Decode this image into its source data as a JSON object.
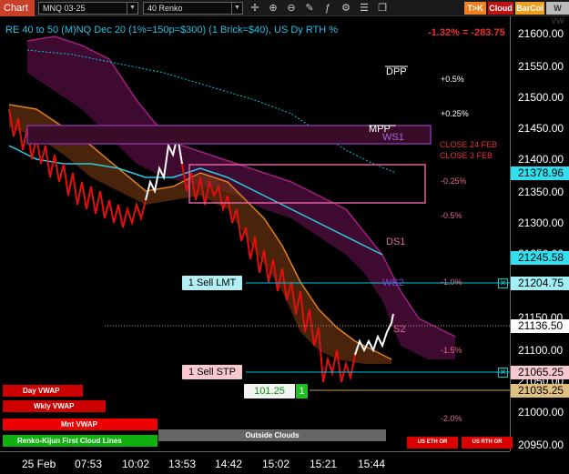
{
  "toolbar": {
    "chart_tab": "Chart",
    "symbol": "MNQ 03-25",
    "bar_type": "40 Renko",
    "icons": [
      "crosshair-icon",
      "zoom-in-icon",
      "zoom-out-icon",
      "draw-icon",
      "indicator-icon",
      "strategy-icon",
      "properties-icon",
      "duplicate-icon"
    ],
    "btn_tok": "T>K",
    "btn_cloud": "Cloud",
    "btn_barcol": "BarCol",
    "btn_ww": "W VW"
  },
  "chart_title": "RE 40 to 50 (M)NQ Dec 20 (1%=150p=$300) (1 Brick=$40), US Dy RTH %",
  "pnl": "-1.32% = -283.75",
  "price_axis": [
    "21600.00",
    "21550.00",
    "21500.00",
    "21450.00",
    "21400.00",
    "21350.00",
    "21300.00",
    "21250.00",
    "21200.00",
    "21150.00",
    "21100.00",
    "21050.00",
    "21000.00",
    "20950.00"
  ],
  "time_axis": [
    "25 Feb",
    "07:53",
    "10:02",
    "13:53",
    "14:42",
    "15:02",
    "15:21",
    "15:44"
  ],
  "price_tags": {
    "last": "21378.96",
    "p1": "21245.58",
    "p2": "21204.75",
    "p3": "21136.50",
    "p4": "21065.25",
    "p5": "21035.25"
  },
  "levels": {
    "dpp": "DPP",
    "mpp": "MPP",
    "ws1": "WS1",
    "ds1": "DS1",
    "ws2": "WS2",
    "ds2": "S2",
    "close24": "CLOSE 24 FEB",
    "close3": "CLOSE 3 FEB"
  },
  "percents": [
    "+0.5%",
    "+0.25%",
    "-0.25%",
    "-0.5%",
    "-1.0%",
    "-1.5%",
    "-2.0%"
  ],
  "orders": {
    "sell_lmt": "1 Sell LMT",
    "sell_stp": "1 Sell STP",
    "position_price": "101.25",
    "position_qty": "1",
    "close_icon": "close-icon"
  },
  "panel": {
    "day_vwap": "Day VWAP",
    "wkly_vwap": "Wkly VWAP",
    "mnt_vwap": "Mnt VWAP",
    "renko_kijun": "Renko-Kijun First Cloud Lines",
    "outside_clouds": "Outside Clouds",
    "us_eth_or": "US ETH OR",
    "us_rth_or": "US RTH OR"
  },
  "colors": {
    "accent_cyan": "#00d8e8",
    "ichimoku_cloud": "#5a1040",
    "kijun_orange": "#e08020",
    "renko_red": "#d81010",
    "renko_white": "#ffffff",
    "tenkan_cyan": "#28c0e0"
  }
}
